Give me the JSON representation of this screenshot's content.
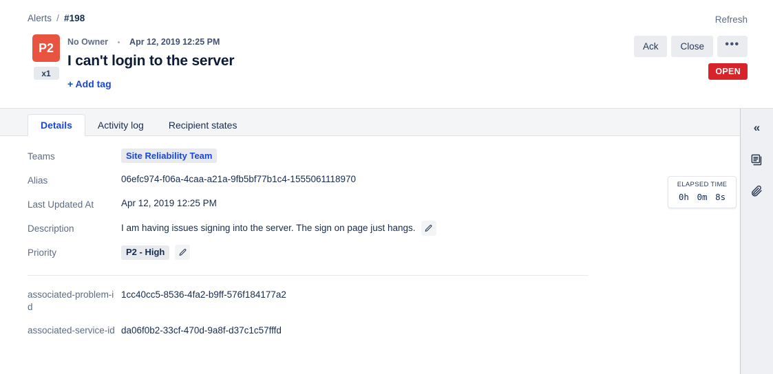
{
  "breadcrumb": {
    "root": "Alerts",
    "separator": "/",
    "current": "#198"
  },
  "header": {
    "refresh_label": "Refresh",
    "priority_badge": "P2",
    "count_chip": "x1",
    "owner": "No Owner",
    "timestamp": "Apr 12, 2019 12:25 PM",
    "title": "I can't login to the server",
    "add_tag_label": "+ Add tag",
    "status": "OPEN",
    "buttons": [
      {
        "label": "Ack",
        "name": "ack-button"
      },
      {
        "label": "Close",
        "name": "close-button"
      }
    ],
    "more_label": "•••"
  },
  "tabs": [
    {
      "label": "Details",
      "active": true
    },
    {
      "label": "Activity log",
      "active": false
    },
    {
      "label": "Recipient states",
      "active": false
    }
  ],
  "details": {
    "teams": {
      "label": "Teams",
      "value": "Site Reliability Team"
    },
    "alias": {
      "label": "Alias",
      "value": "06efc974-f06a-4caa-a21a-9fb5bf77b1c4-1555061118970"
    },
    "last_updated": {
      "label": "Last Updated At",
      "value": "Apr 12, 2019 12:25 PM"
    },
    "description": {
      "label": "Description",
      "value": "I am having issues signing into the server. The sign on page just hangs."
    },
    "priority": {
      "label": "Priority",
      "value": "P2 - High"
    }
  },
  "custom_fields": [
    {
      "label": "associated-problem-id",
      "value": "1cc40cc5-8536-4fa2-b9ff-576f184177a2"
    },
    {
      "label": "associated-service-id",
      "value": "da06f0b2-33cf-470d-9a8f-d37c1c57fffd"
    }
  ],
  "elapsed": {
    "label": "ELAPSED TIME",
    "hours": "0h",
    "minutes": "0m",
    "seconds": "8s"
  },
  "rail": {
    "collapse": "«"
  },
  "colors": {
    "priority_badge": "#e8543f",
    "status_open": "#d9232a",
    "link": "#1a46d6",
    "tab_strip": "#f4f5f7",
    "rail_bg": "#eef0f3"
  }
}
